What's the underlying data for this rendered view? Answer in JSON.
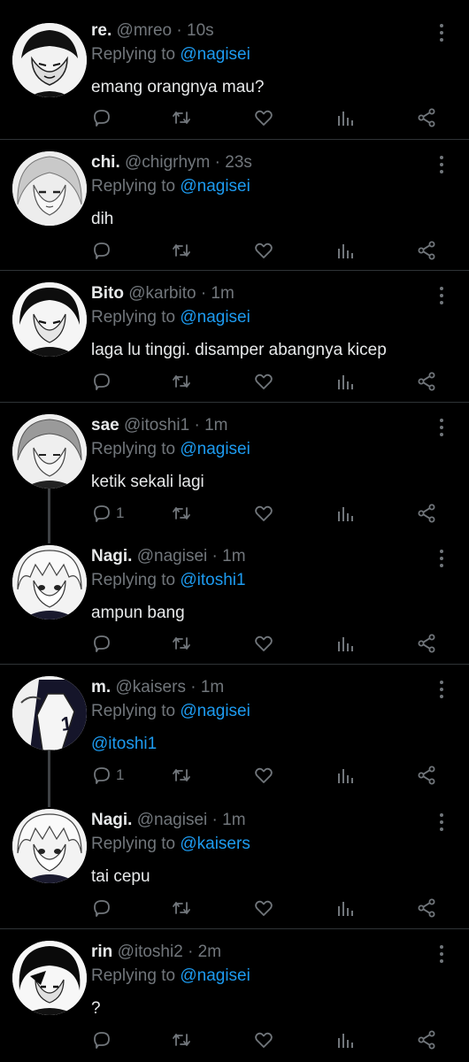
{
  "tweets": [
    {
      "name": "re.",
      "handle": "@mreo",
      "time": "· 10s",
      "reply_prefix": "Replying to",
      "reply_to": "@nagisei",
      "text": "emang orangnya mau?",
      "text_mention": "",
      "reply_count": ""
    },
    {
      "name": "chi.",
      "handle": "@chigrhym",
      "time": "· 23s",
      "reply_prefix": "Replying to",
      "reply_to": "@nagisei",
      "text": "dih",
      "text_mention": "",
      "reply_count": ""
    },
    {
      "name": "Bito",
      "handle": "@karbito",
      "time": "· 1m",
      "reply_prefix": "Replying to",
      "reply_to": "@nagisei",
      "text": "laga lu tinggi. disamper abangnya kicep",
      "text_mention": "",
      "reply_count": ""
    },
    {
      "name": "sae",
      "handle": "@itoshi1",
      "time": "· 1m",
      "reply_prefix": "Replying to",
      "reply_to": "@nagisei",
      "text": "ketik sekali lagi",
      "text_mention": "",
      "reply_count": "1"
    },
    {
      "name": "Nagi.",
      "handle": "@nagisei",
      "time": "· 1m",
      "reply_prefix": "Replying to",
      "reply_to": "@itoshi1",
      "text": "ampun bang",
      "text_mention": "",
      "reply_count": ""
    },
    {
      "name": "m.",
      "handle": "@kaisers",
      "time": "· 1m",
      "reply_prefix": "Replying to",
      "reply_to": "@nagisei",
      "text": "",
      "text_mention": "@itoshi1",
      "reply_count": "1"
    },
    {
      "name": "Nagi.",
      "handle": "@nagisei",
      "time": "· 1m",
      "reply_prefix": "Replying to",
      "reply_to": "@kaisers",
      "text": "tai cepu",
      "text_mention": "",
      "reply_count": ""
    },
    {
      "name": "rin",
      "handle": "@itoshi2",
      "time": "· 2m",
      "reply_prefix": "Replying to",
      "reply_to": "@nagisei",
      "text": "?",
      "text_mention": "",
      "reply_count": ""
    }
  ],
  "icons": {
    "more": "more-vertical-icon",
    "reply": "reply-icon",
    "retweet": "retweet-icon",
    "like": "like-icon",
    "views": "views-icon",
    "share": "share-icon"
  },
  "colors": {
    "background": "#000000",
    "name": "#e7e9ea",
    "meta": "#71767b",
    "mention": "#1d9bf0",
    "separator": "#2f3336"
  }
}
